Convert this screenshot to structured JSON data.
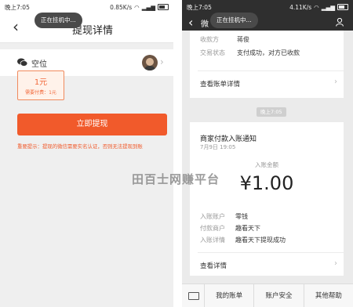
{
  "watermark": "田百士网赚平台",
  "left": {
    "status": {
      "time": "晚上7:05",
      "speed": "0.85K/s"
    },
    "toast": "正在挂机中...",
    "title": "提现详情",
    "user_name": "空位",
    "amount": "1元",
    "fee": "需要付费：1元",
    "button": "立即提现",
    "notice": "重要提示：提现的微信需要实名认证，否则无法提现到账"
  },
  "right": {
    "status": {
      "time": "晚上7:05",
      "speed": "4.11K/s"
    },
    "toast": "正在挂机中...",
    "back_label": "微",
    "card1": {
      "rows": [
        {
          "key": "收款方",
          "value": "蒋俊"
        },
        {
          "key": "交易状态",
          "value": "支付成功，对方已收款"
        }
      ],
      "link": "查看账单详情"
    },
    "time_chip": "晚上7:05",
    "card2": {
      "title": "商家付款入账通知",
      "time": "7月9日  19:05",
      "amount_label": "入账金额",
      "amount": "¥1.00",
      "rows": [
        {
          "key": "入账账户",
          "value": "零钱"
        },
        {
          "key": "付款商户",
          "value": "趣看天下"
        },
        {
          "key": "入账详情",
          "value": "趣看天下提现成功"
        }
      ],
      "link": "查看详情"
    },
    "bottom_menu": [
      "我的账单",
      "账户安全",
      "其他帮助"
    ]
  }
}
